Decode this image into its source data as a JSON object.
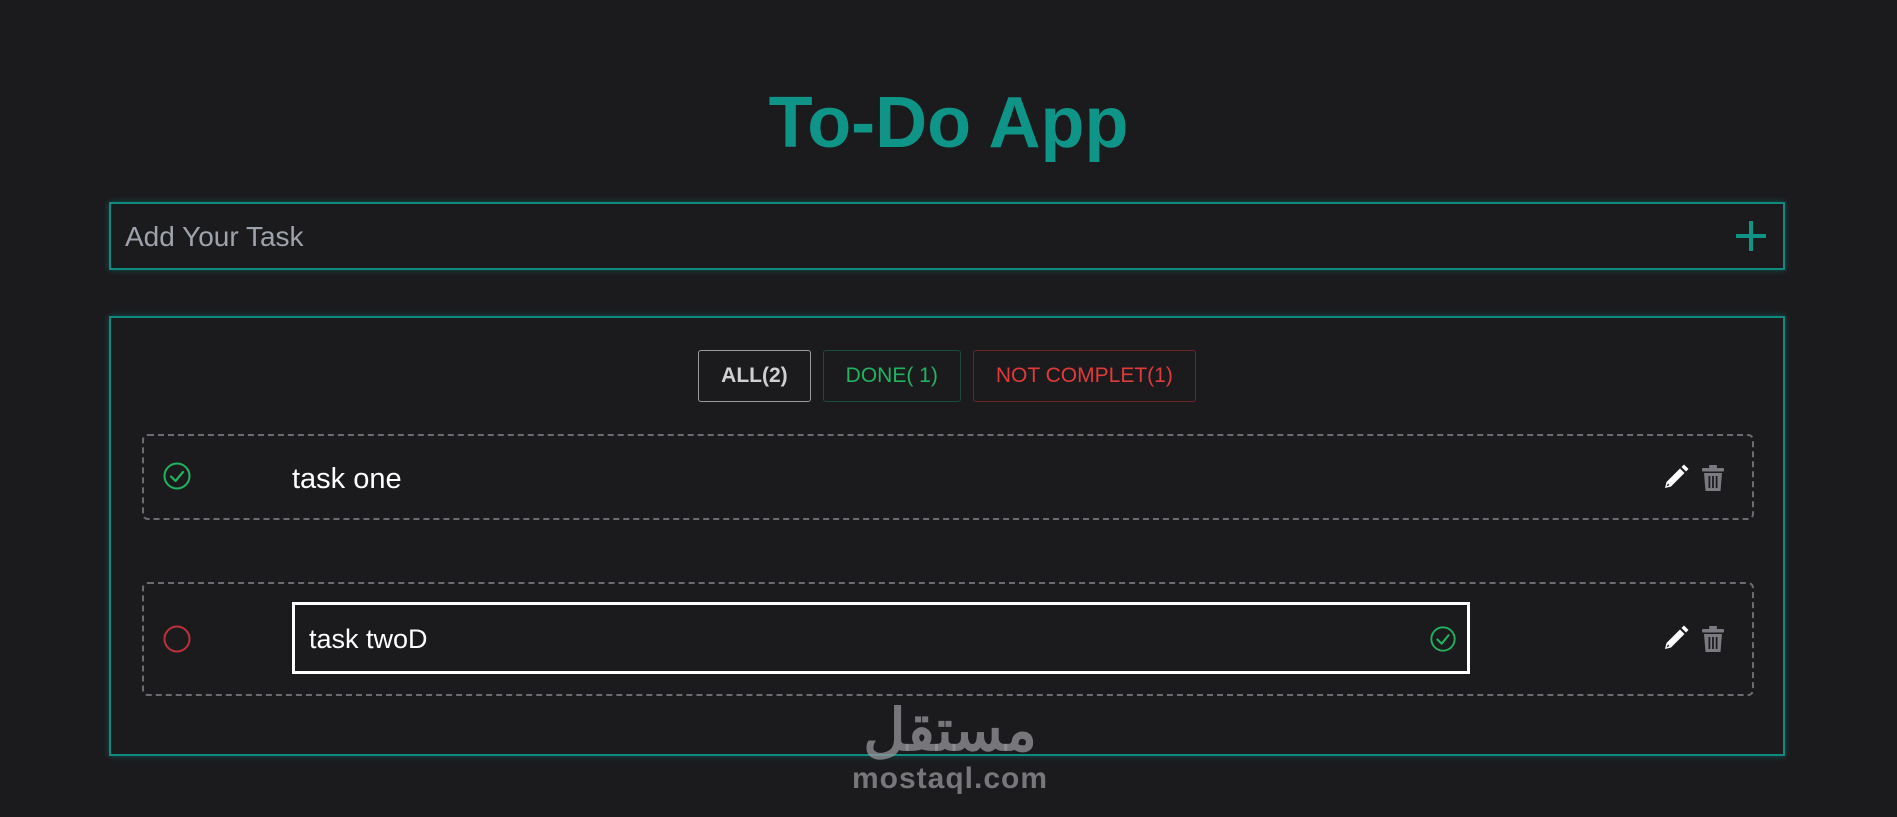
{
  "app": {
    "title": "To-Do App"
  },
  "add_task": {
    "placeholder": "Add Your Task",
    "value": "",
    "add_icon": "plus-icon"
  },
  "filters": [
    {
      "label": "ALL(2)",
      "color": "#d0d0d0",
      "active": true
    },
    {
      "label": "DONE( 1)",
      "color": "#22b35f",
      "active": false
    },
    {
      "label": "NOT COMPLET(1)",
      "color": "#e03a3a",
      "active": false
    }
  ],
  "tasks": [
    {
      "text": "task one",
      "done": true,
      "status_icon": "check-circle-icon",
      "editing": false
    },
    {
      "text": "task twoD",
      "done": false,
      "status_icon": "empty-circle-icon",
      "editing": true,
      "confirm_icon": "check-circle-icon"
    }
  ],
  "icons": {
    "edit": "pencil-icon",
    "delete": "trash-icon"
  },
  "colors": {
    "accent": "#0f9488",
    "done": "#22b35f",
    "not_complete": "#e03a3a",
    "background": "#1b1b1e"
  },
  "watermark": {
    "arabic": "مستقل",
    "latin": "mostaql.com"
  }
}
